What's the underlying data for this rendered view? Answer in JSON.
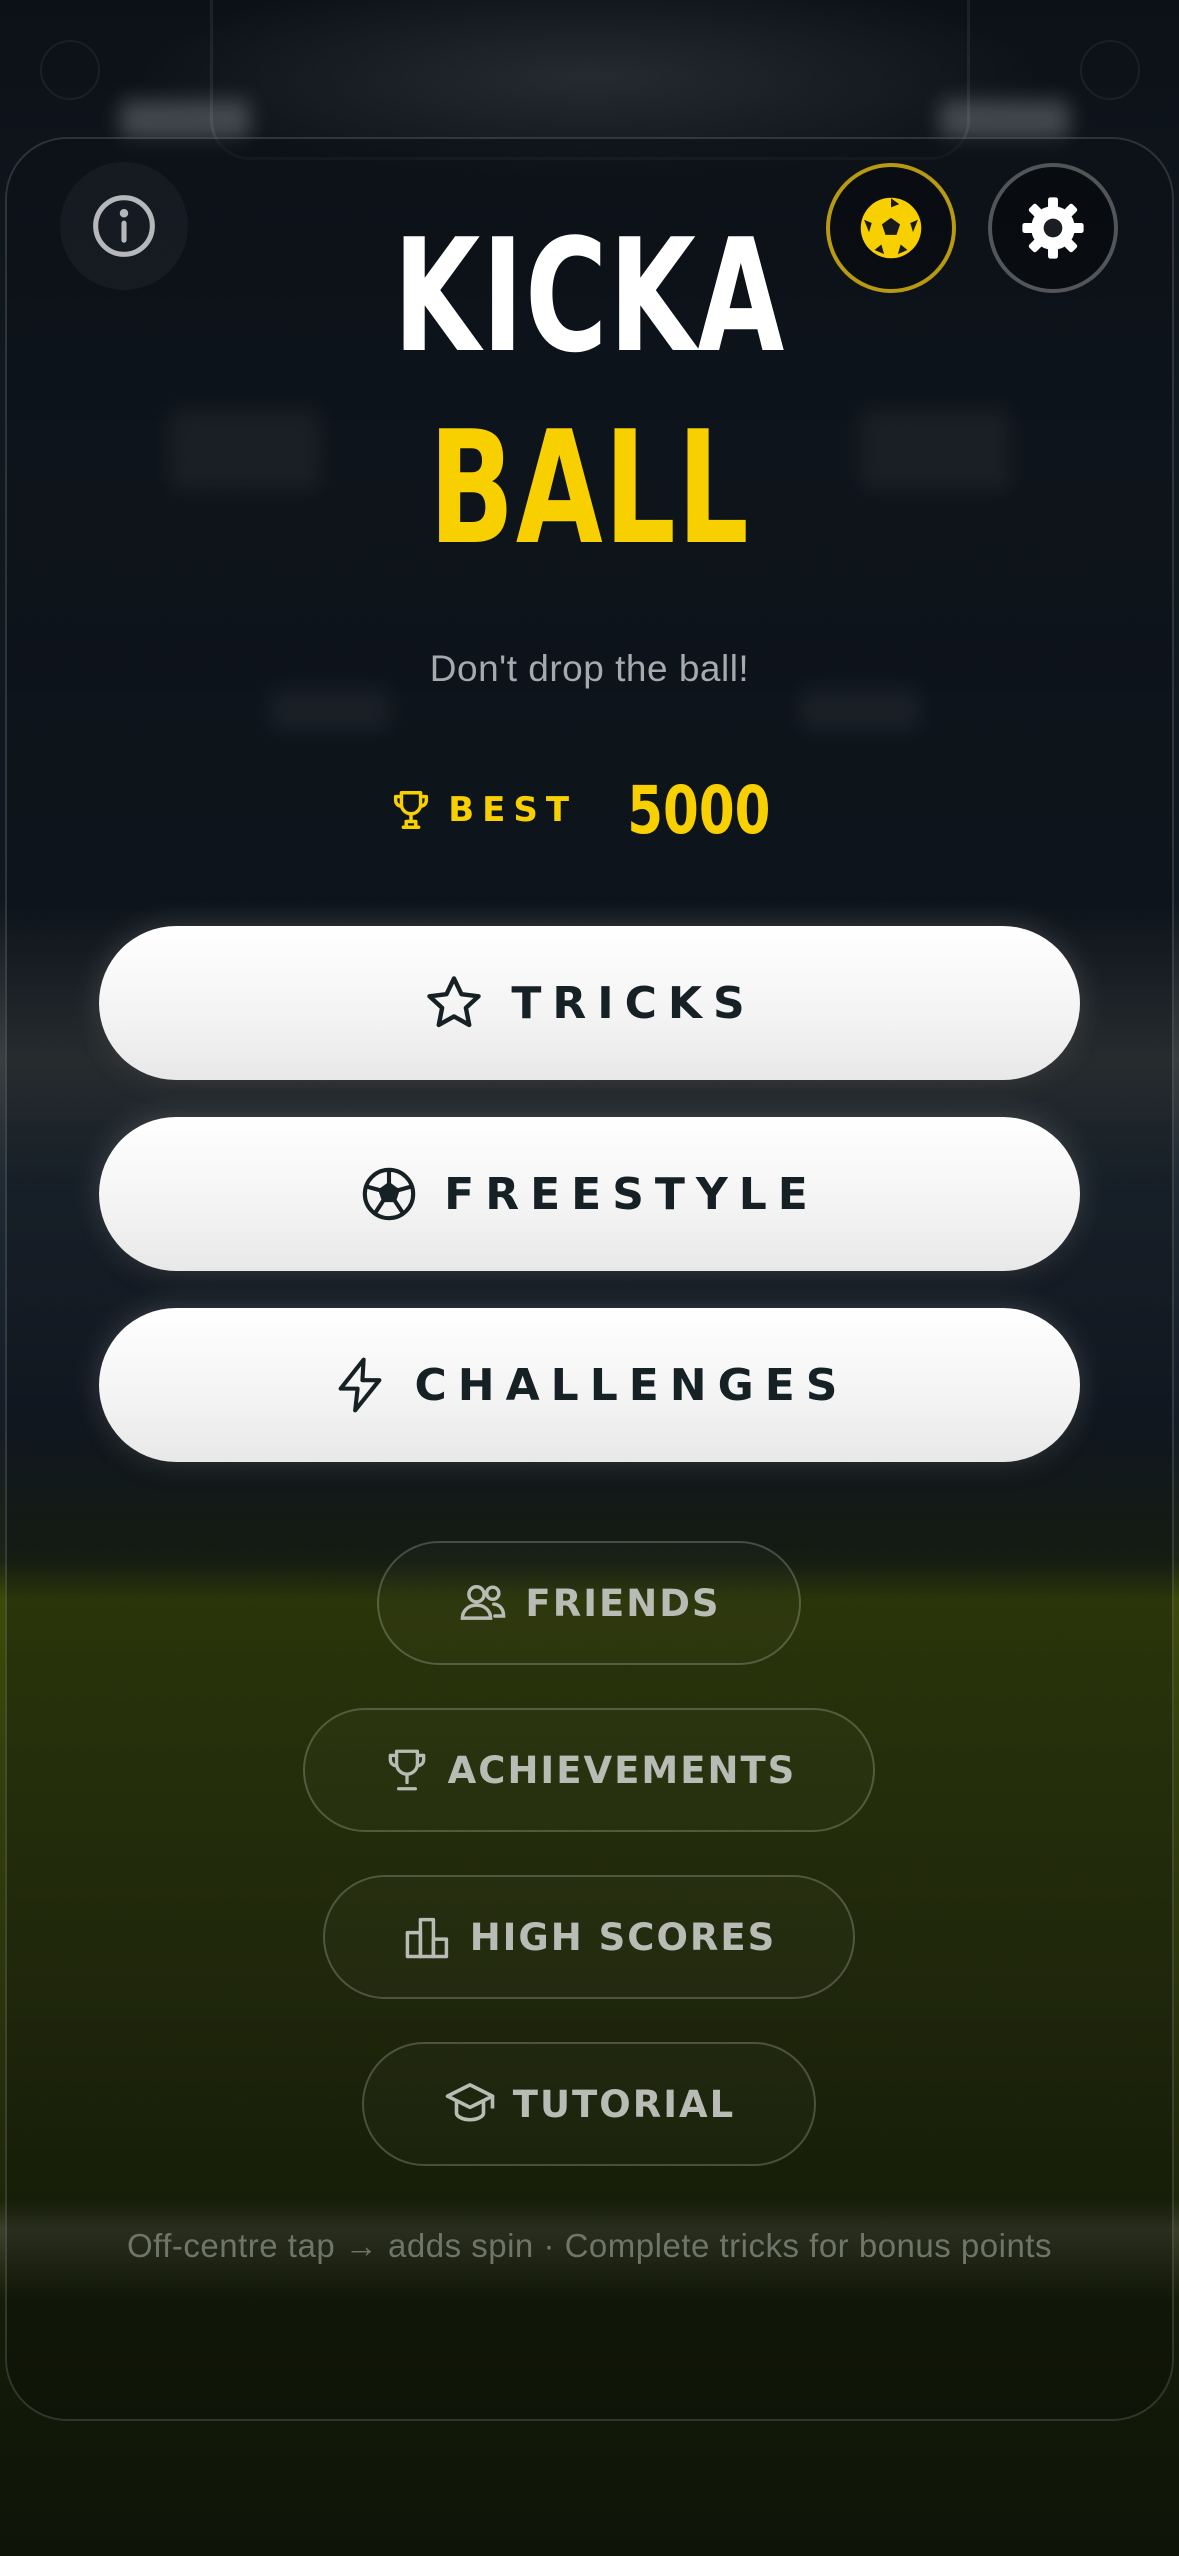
{
  "header": {
    "info_icon": "info-circle-icon",
    "ball_icon": "soccer-ball-icon",
    "settings_icon": "gear-icon"
  },
  "title": {
    "line1": "KICKA",
    "line2": "BALL"
  },
  "tagline": "Don't drop the ball!",
  "best": {
    "label": "BEST",
    "value": "5000",
    "icon": "trophy-icon"
  },
  "primary_buttons": [
    {
      "label": "TRICKS",
      "icon": "star-icon"
    },
    {
      "label": "FREESTYLE",
      "icon": "soccer-ball-icon"
    },
    {
      "label": "CHALLENGES",
      "icon": "lightning-icon"
    }
  ],
  "secondary_buttons": [
    {
      "label": "FRIENDS",
      "icon": "users-icon"
    },
    {
      "label": "ACHIEVEMENTS",
      "icon": "trophy-icon"
    },
    {
      "label": "HIGH SCORES",
      "icon": "bar-chart-icon"
    },
    {
      "label": "TUTORIAL",
      "icon": "graduation-cap-icon"
    }
  ],
  "footer_hint": "Off-centre tap → adds spin  ·  Complete tricks for bonus points",
  "colors": {
    "accent": "#f8d000",
    "button_text": "#162126",
    "muted_text": "#a6a9ad"
  }
}
